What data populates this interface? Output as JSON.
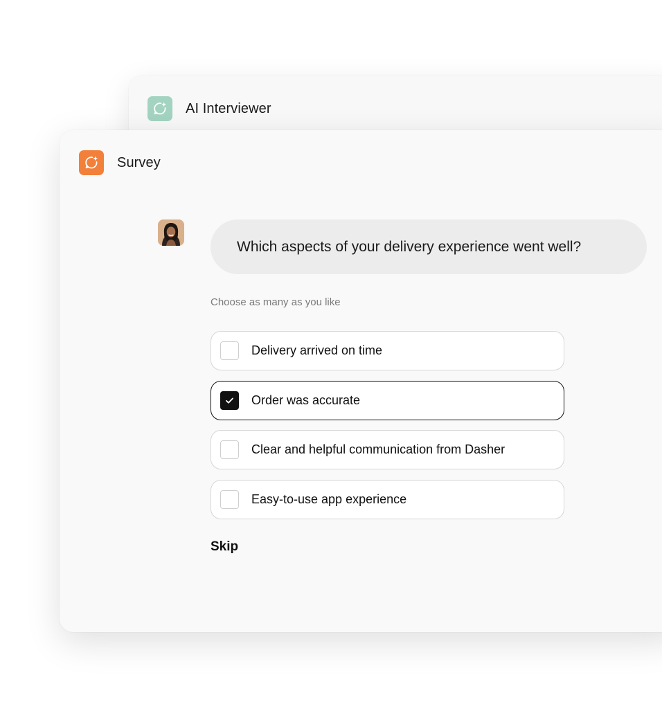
{
  "back_window": {
    "title": "AI Interviewer",
    "icon": "sparkle-chat-icon",
    "icon_color": "#a3d3c1"
  },
  "front_window": {
    "title": "Survey",
    "icon": "sparkle-chat-icon",
    "icon_color": "#f2803a"
  },
  "question": {
    "avatar": "interviewer-avatar",
    "text": "Which aspects of your delivery experience went well?",
    "hint": "Choose as many as you like"
  },
  "options": [
    {
      "label": "Delivery arrived on time",
      "checked": false
    },
    {
      "label": "Order was accurate",
      "checked": true
    },
    {
      "label": "Clear and helpful communication from Dasher",
      "checked": false
    },
    {
      "label": "Easy-to-use app experience",
      "checked": false
    }
  ],
  "skip_label": "Skip",
  "colors": {
    "accent_dark": "#111111",
    "bubble": "#ececec",
    "border": "#d6d6d6"
  }
}
